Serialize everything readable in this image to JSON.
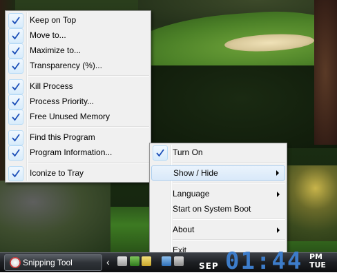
{
  "main_menu": {
    "groups": [
      [
        {
          "label": "Keep on Top",
          "checked": true
        },
        {
          "label": "Move to...",
          "checked": true
        },
        {
          "label": "Maximize to...",
          "checked": true
        },
        {
          "label": "Transparency (%)...",
          "checked": true
        }
      ],
      [
        {
          "label": "Kill Process",
          "checked": true
        },
        {
          "label": "Process Priority...",
          "checked": true
        },
        {
          "label": "Free Unused Memory",
          "checked": true
        }
      ],
      [
        {
          "label": "Find this Program",
          "checked": true
        },
        {
          "label": "Program Information...",
          "checked": true
        }
      ],
      [
        {
          "label": "Iconize to Tray",
          "checked": true
        }
      ]
    ]
  },
  "sub_menu": {
    "turn_on": "Turn On",
    "show_hide": "Show / Hide",
    "language": "Language",
    "start_on_boot": "Start on System Boot",
    "about": "About",
    "exit": "Exit"
  },
  "taskbar": {
    "button_label": "Snipping Tool",
    "tray_chevron": "‹",
    "clock_month": "SEP",
    "clock_time": "01:44",
    "clock_ampm": "PM",
    "clock_day": "TUE"
  },
  "colors": {
    "check_blue": "#1c4fb8",
    "clock_blue": "#3d7cc9",
    "hover_bg": "#dbeaf9"
  }
}
